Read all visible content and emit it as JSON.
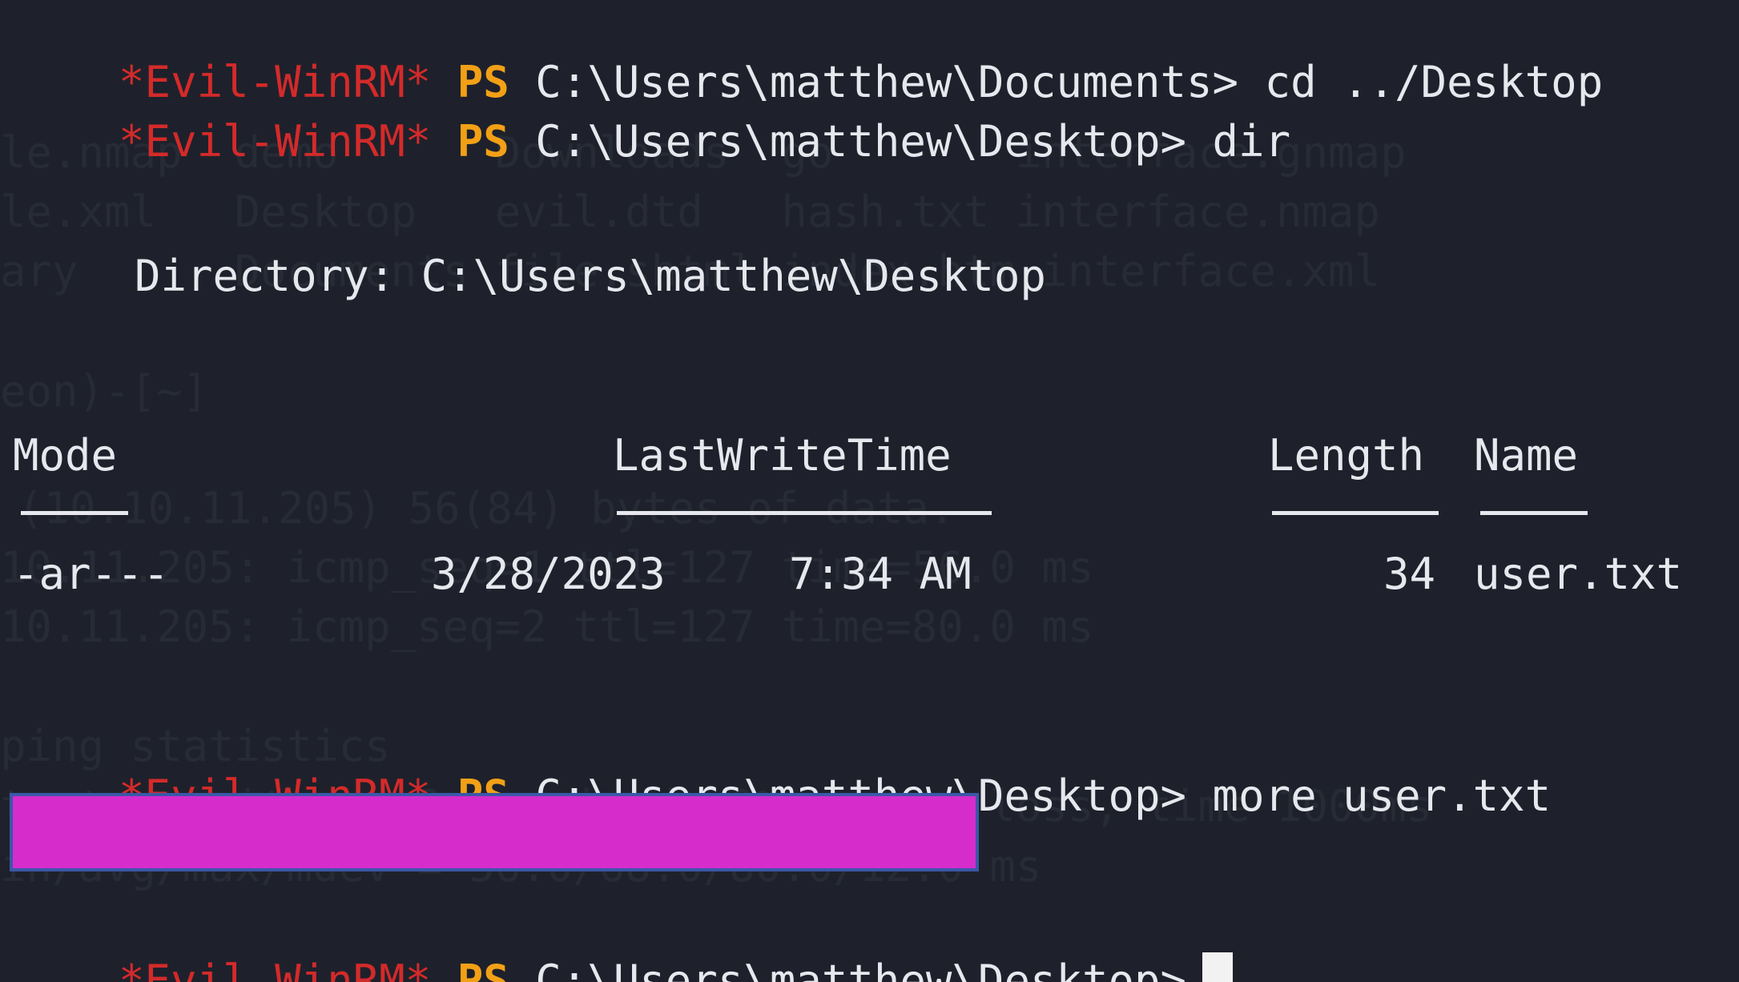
{
  "terminal": {
    "prompt_prefix": "*Evil-WinRM*",
    "prompt_ps": "PS",
    "lines": [
      {
        "path": "C:\\Users\\matthew\\Documents>",
        "command": "cd ../Desktop"
      },
      {
        "path": "C:\\Users\\matthew\\Desktop>",
        "command": "dir"
      },
      {
        "path": "C:\\Users\\matthew\\Desktop>",
        "command": "more user.txt"
      },
      {
        "path": "C:\\Users\\matthew\\Desktop>",
        "command": ""
      }
    ],
    "directory_label": "Directory: C:\\Users\\matthew\\Desktop",
    "table": {
      "headers": {
        "mode": "Mode",
        "lastwritetime": "LastWriteTime",
        "length": "Length",
        "name": "Name"
      },
      "rows": [
        {
          "mode": "-ar---",
          "date": "3/28/2023",
          "time": "7:34 AM",
          "length": "34",
          "name": "user.txt"
        }
      ]
    },
    "user_txt_output": "[redacted]"
  },
  "background_bleed": {
    "lines": [
      "le.nmap  demo      Downloads  go       interface.gnmap",
      "le.xml   Desktop   evil.dtd   hash.txt interface.nmap",
      "ary      Documents file.shtml index.htm interface.xml",
      "eon)-[~]",
      "(10.10.11.205) 56(84) bytes of data.",
      "10.11.205: icmp_seq=1 ttl=127 time=56.0 ms",
      "10.11.205: icmp_seq=2 ttl=127 time=80.0 ms",
      "ping statistics",
      "ts transmitted, 2 received, 0% packet loss, time 1000ms",
      "in/avg/max/mdev = 56.0/68.0/80.0/12.0 ms"
    ]
  }
}
